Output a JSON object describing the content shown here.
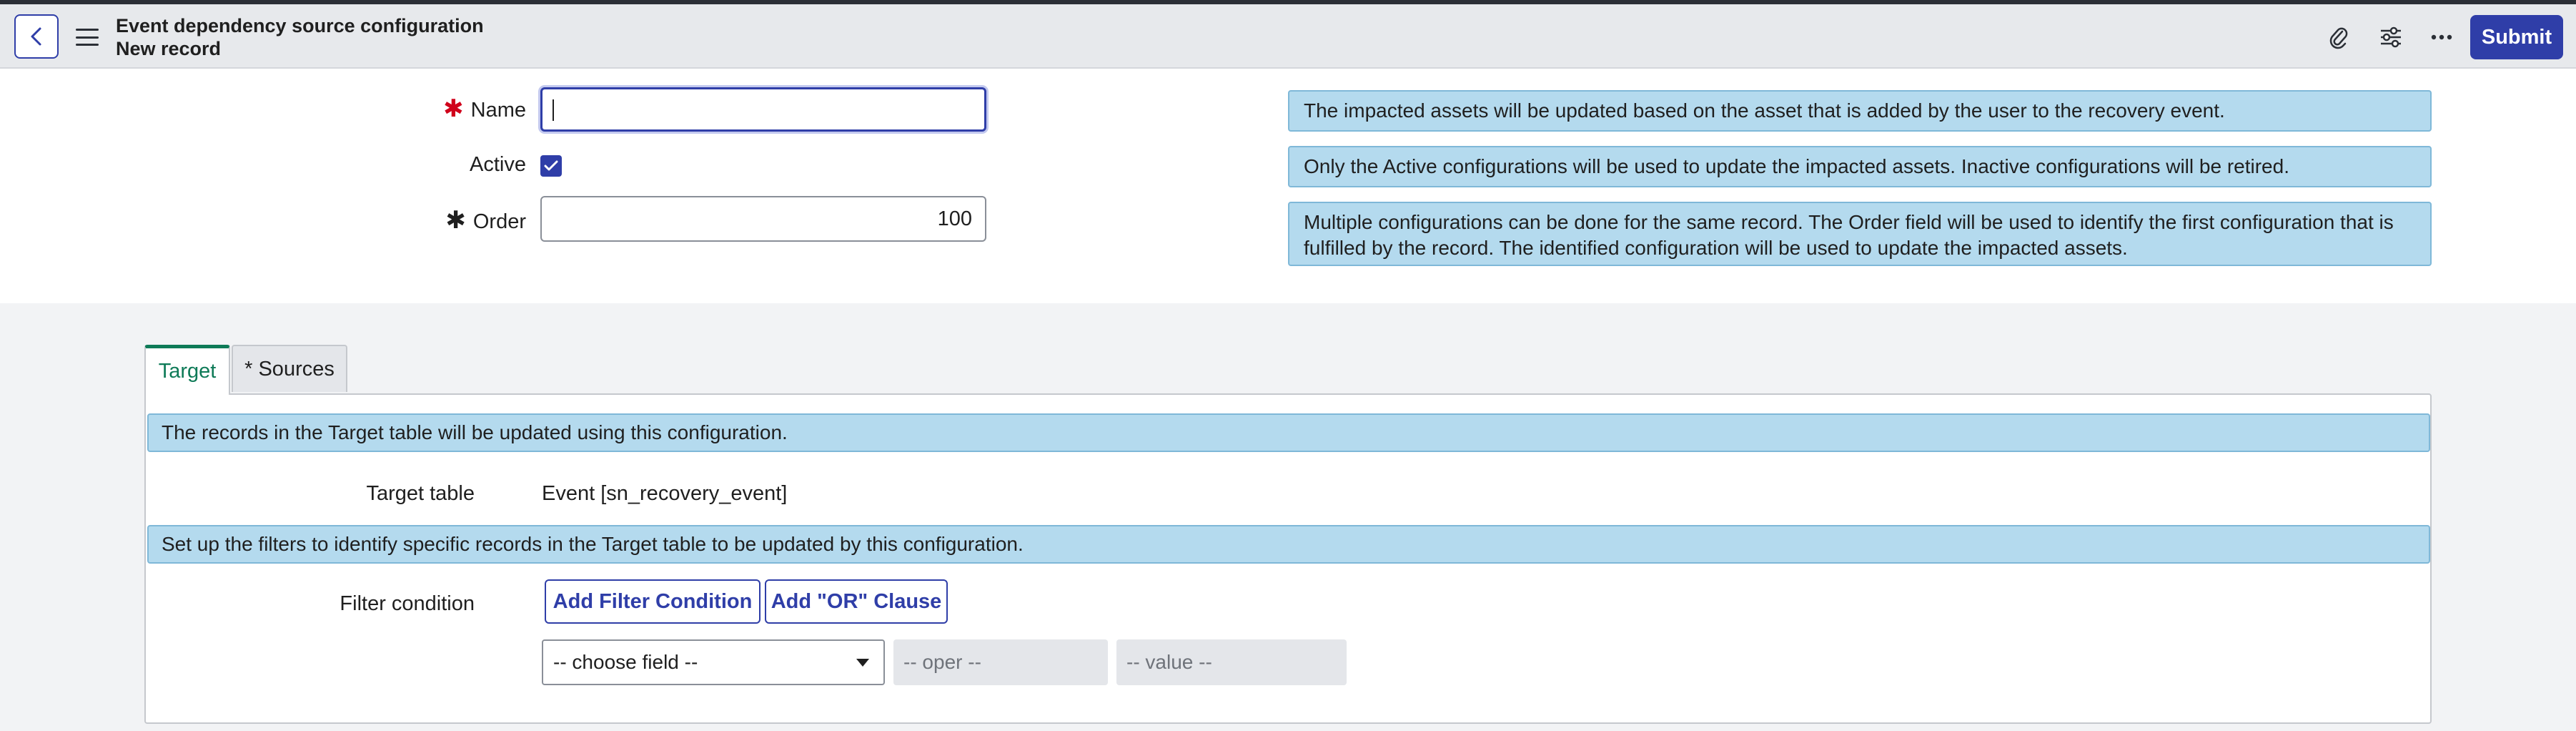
{
  "header": {
    "title": "Event dependency source configuration",
    "subtitle": "New record",
    "submit_label": "Submit",
    "icons": [
      "chevron-left-icon",
      "hamburger-menu-icon",
      "paperclip-icon",
      "sliders-icon",
      "more-icon"
    ]
  },
  "form": {
    "name_label": "Name",
    "name_value": "",
    "active_label": "Active",
    "active_checked": true,
    "order_label": "Order",
    "order_value": "100",
    "info_messages": [
      "The impacted assets will be updated based on the asset that is added by the user to the recovery event.",
      "Only the Active configurations will be used to update the impacted assets. Inactive configurations will be retired.",
      "Multiple configurations can be done for the same record. The Order field will be used to identify the first configuration that is fulfilled by the record. The identified configuration will be used to update the impacted assets."
    ]
  },
  "tabs": [
    {
      "label": "Target",
      "active": true
    },
    {
      "label": "* Sources",
      "active": false
    }
  ],
  "target_panel": {
    "info_top": "The records in the Target table will be updated using this configuration.",
    "target_table_label": "Target table",
    "target_table_value": "Event [sn_recovery_event]",
    "info_filters": "Set up the filters to identify specific records in the Target table to be updated by this configuration.",
    "filter_label": "Filter condition",
    "add_filter_label": "Add Filter Condition",
    "add_or_label": "Add \"OR\" Clause",
    "choose_field": "-- choose field --",
    "oper": "-- oper --",
    "value": "-- value --"
  },
  "colors": {
    "accent": "#2f3ea8",
    "active_tab": "#0e7a57",
    "required": "#d0021b",
    "info_bg": "#b4daee"
  }
}
